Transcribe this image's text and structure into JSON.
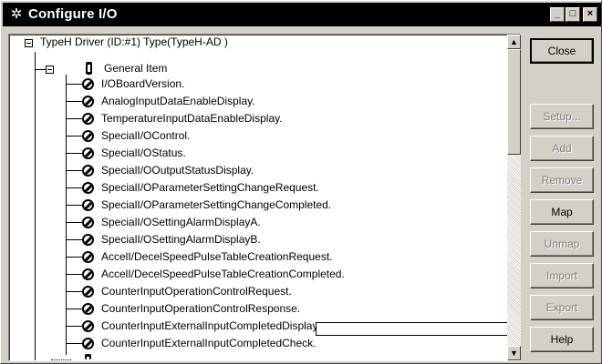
{
  "window": {
    "title": "Configure I/O",
    "icon": "gear-icon",
    "caption_buttons": {
      "minimize": "_",
      "maximize": "□",
      "close": "×"
    }
  },
  "tree": {
    "root_label": "TypeH Driver (ID:#1) Type(TypeH-AD )",
    "group_label": "General Item",
    "items": [
      "I/OBoardVersion.",
      "AnalogInputDataEnableDisplay.",
      "TemperatureInputDataEnableDisplay.",
      "SpecialI/OControl.",
      "SpecialI/OStatus.",
      "SpecialI/OOutputStatusDisplay.",
      "SpecialI/OParameterSettingChangeRequest.",
      "SpecialI/OParameterSettingChangeCompleted.",
      "SpecialI/OSettingAlarmDisplayA.",
      "SpecialI/OSettingAlarmDisplayB.",
      "AccelI/DecelSpeedPulseTableCreationRequest.",
      "AccelI/DecelSpeedPulseTableCreationCompleted.",
      "CounterInputOperationControlRequest.",
      "CounterInputOperationControlResponse.",
      "CounterInputExternalInputCompletedDisplay.",
      "CounterInputExternalInputCompletedCheck."
    ],
    "edit_value": ""
  },
  "buttons": {
    "close": "Close",
    "setup": "Setup...",
    "add": "Add",
    "remove": "Remove",
    "map": "Map",
    "unmap": "Unmap",
    "import": "Import",
    "export": "Export",
    "help": "Help"
  }
}
